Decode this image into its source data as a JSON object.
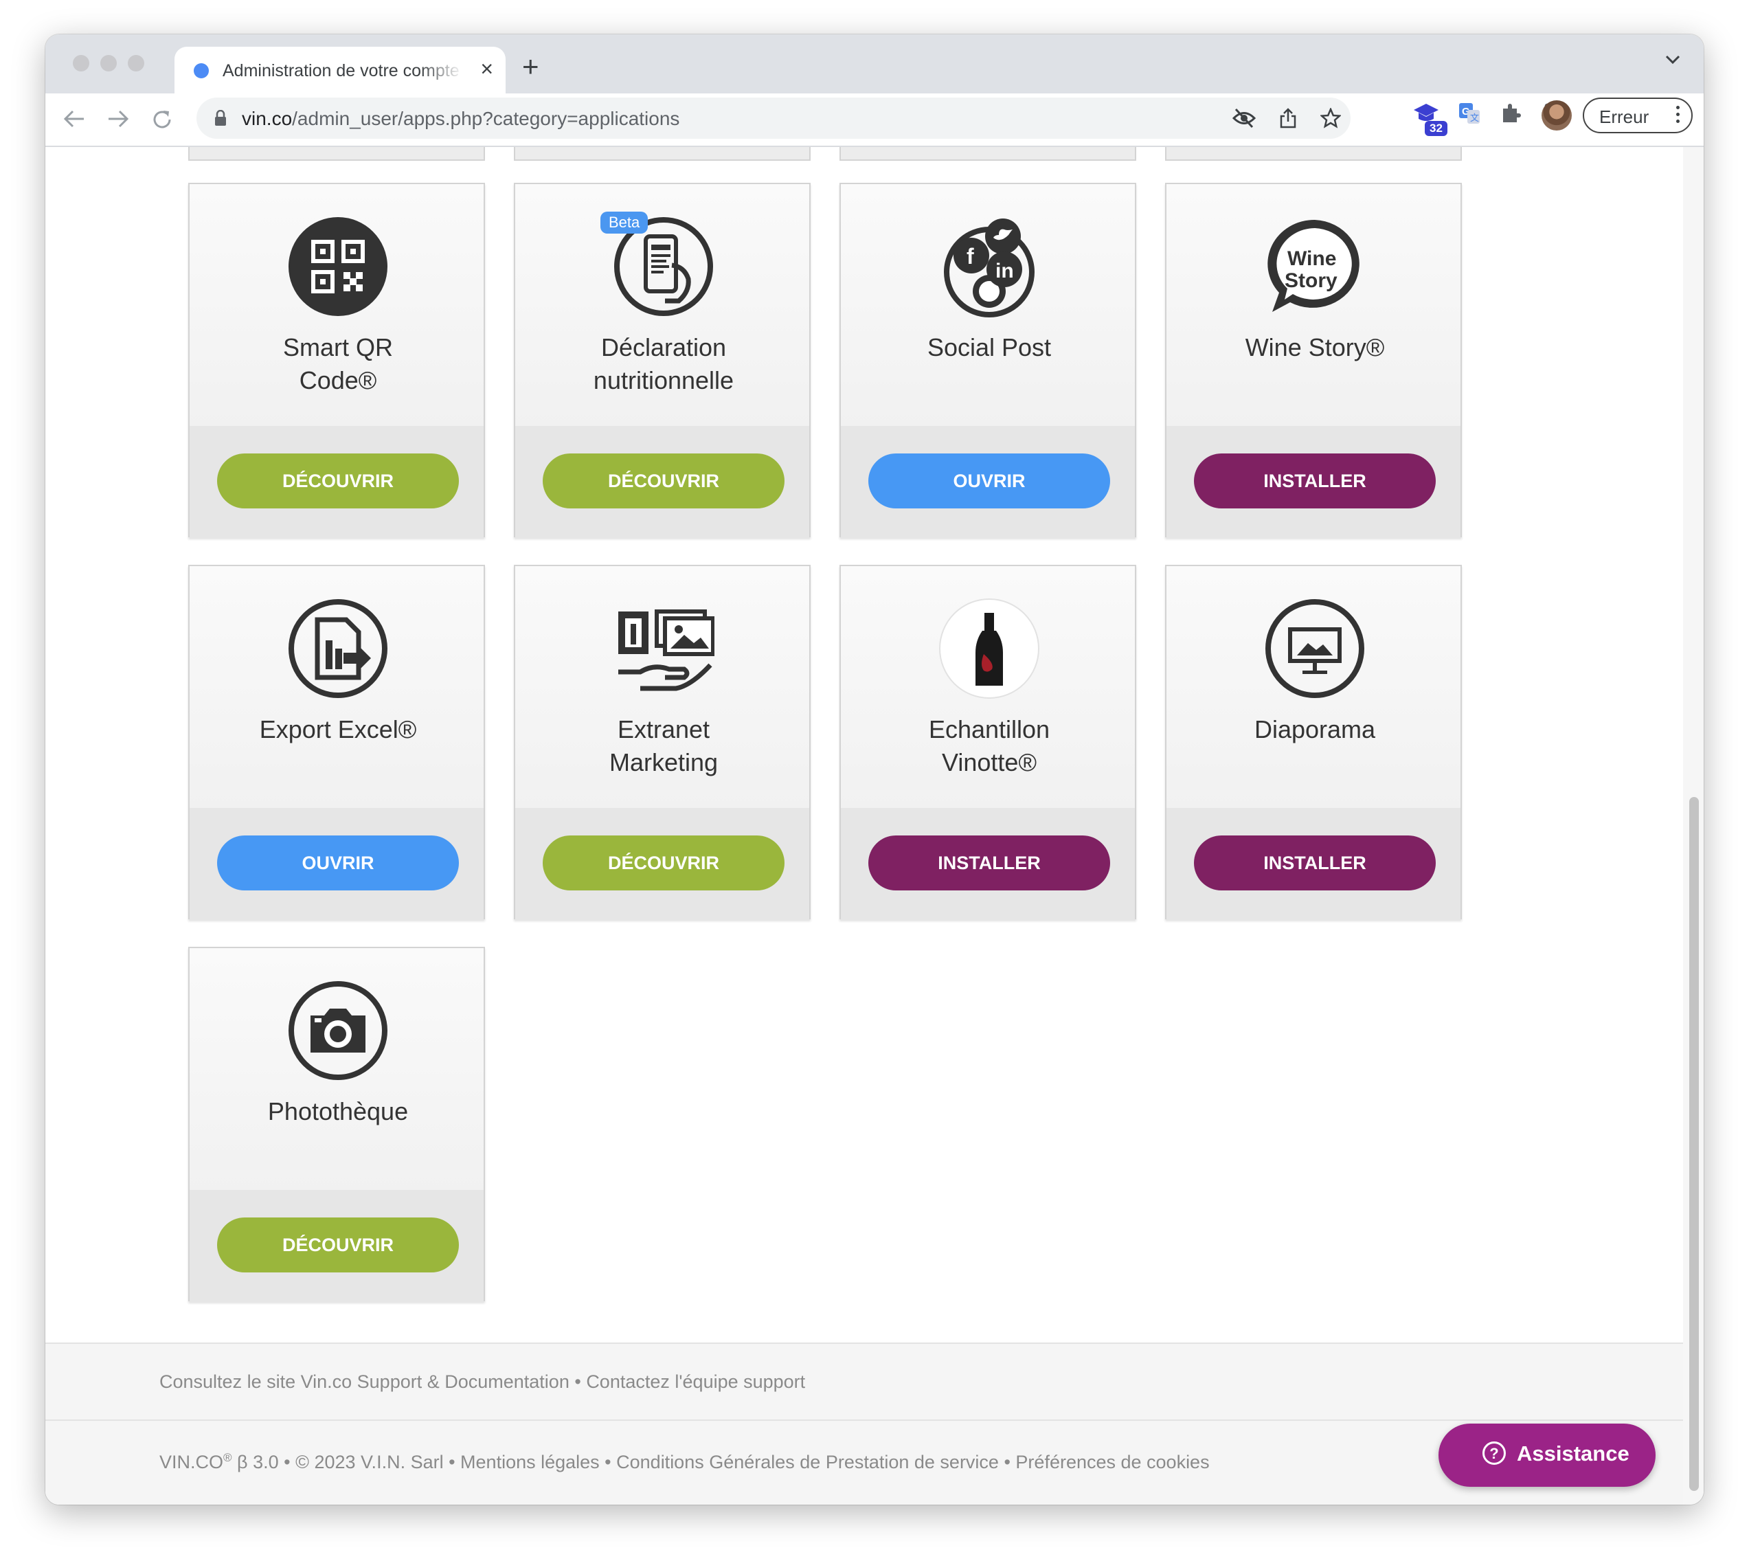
{
  "browser": {
    "tab_title": "Administration de votre compte",
    "new_tab": "+",
    "close_tab": "×",
    "url_host": "vin.co",
    "url_path": "/admin_user/apps.php?category=applications",
    "extension_badge": "32",
    "profile_button": "Erreur"
  },
  "colors": {
    "green": "#9ab63c",
    "blue": "#4798f4",
    "purple": "#7f2162",
    "assistance": "#9b2387"
  },
  "apps": [
    {
      "title_l1": "Smart QR",
      "title_l2": "Code®",
      "button": "DÉCOUVRIR",
      "icon": "qr-code-icon",
      "button_color": "green"
    },
    {
      "title_l1": "Déclaration",
      "title_l2": "nutritionnelle",
      "button": "DÉCOUVRIR",
      "icon": "phone-hand-icon",
      "button_color": "green",
      "badge": "Beta"
    },
    {
      "title_l1": "Social Post",
      "title_l2": "",
      "button": "OUVRIR",
      "icon": "social-media-icon",
      "button_color": "blue"
    },
    {
      "title_l1": "Wine Story®",
      "title_l2": "",
      "button": "INSTALLER",
      "icon": "wine-story-logo-icon",
      "button_color": "purple"
    },
    {
      "title_l1": "Export Excel®",
      "title_l2": "",
      "button": "OUVRIR",
      "icon": "export-document-icon",
      "button_color": "blue"
    },
    {
      "title_l1": "Extranet",
      "title_l2": "Marketing",
      "button": "DÉCOUVRIR",
      "icon": "marketing-brochure-icon",
      "button_color": "green"
    },
    {
      "title_l1": "Echantillon",
      "title_l2": "Vinotte®",
      "button": "INSTALLER",
      "icon": "wine-bottle-icon",
      "button_color": "purple"
    },
    {
      "title_l1": "Diaporama",
      "title_l2": "",
      "button": "INSTALLER",
      "icon": "slideshow-icon",
      "button_color": "purple"
    },
    {
      "title_l1": "Photothèque",
      "title_l2": "",
      "button": "DÉCOUVRIR",
      "icon": "camera-icon",
      "button_color": "green"
    }
  ],
  "footer": {
    "site_link": "Consultez le site Vin.co Support & Documentation",
    "sep": " • ",
    "contact_link": "Contactez l'équipe support",
    "brand": "VIN.CO",
    "reg": "®",
    "version": " β 3.0 • © 2023 V.I.N. Sarl • ",
    "legal": "Mentions légales",
    "cgps": "Conditions Générales de Prestation de service",
    "cookies": "Préférences de cookies"
  },
  "assistance": {
    "label": "Assistance",
    "icon_char": "?"
  }
}
